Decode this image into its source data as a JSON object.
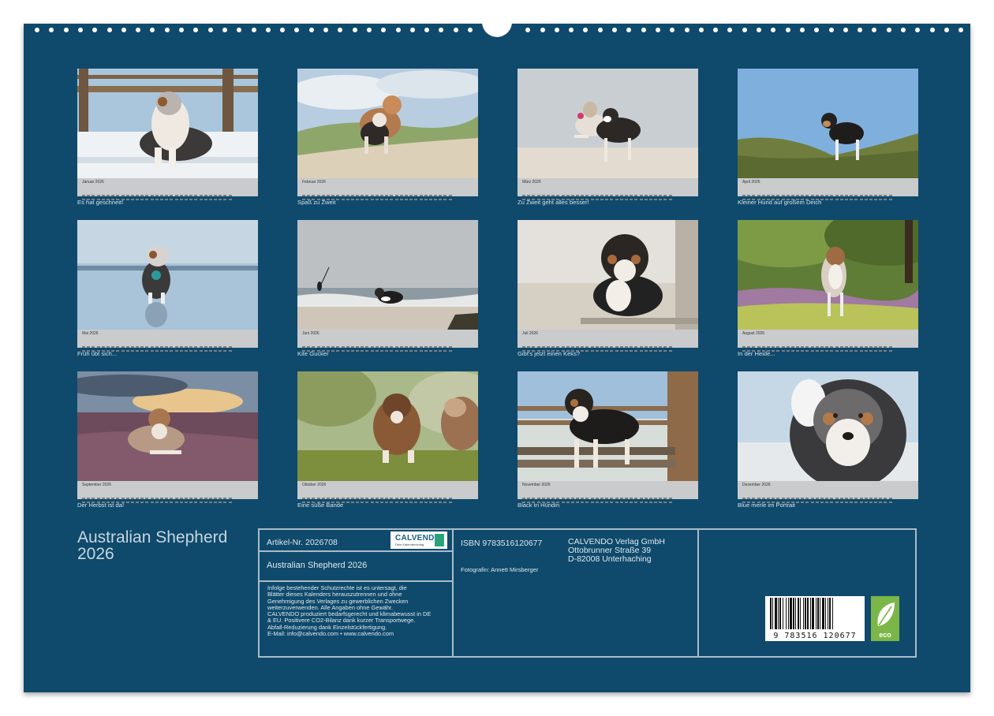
{
  "calendar": {
    "title_line1": "Australian Shepherd",
    "title_line2": "2026",
    "tiles": [
      {
        "month": "Januar 2026",
        "caption": "Es hat geschneit!",
        "scene": "snow-dog"
      },
      {
        "month": "Februar 2026",
        "caption": "Spaß zu Zweit",
        "scene": "dune-two-dogs"
      },
      {
        "month": "März 2026",
        "caption": "Zu Zweit geht alles besser!",
        "scene": "beach-two-dogs"
      },
      {
        "month": "April 2026",
        "caption": "Kleiner Hund auf großem Deich",
        "scene": "dike-puppy"
      },
      {
        "month": "Mai 2026",
        "caption": "Früh übt sich...",
        "scene": "water-puppy"
      },
      {
        "month": "Juni 2026",
        "caption": "Kite Gucker",
        "scene": "kite-beach"
      },
      {
        "month": "Juli 2026",
        "caption": "Gibt's jetzt einen Keks?",
        "scene": "bench-dog"
      },
      {
        "month": "August 2026",
        "caption": "In der Heide...",
        "scene": "heath-dog"
      },
      {
        "month": "September 2026",
        "caption": "Der Herbst ist da!",
        "scene": "sunset-heath"
      },
      {
        "month": "Oktober 2026",
        "caption": "Eine süße Bande",
        "scene": "puppies-grass"
      },
      {
        "month": "November 2026",
        "caption": "Black tri Hündin",
        "scene": "pier-dog"
      },
      {
        "month": "Dezember 2026",
        "caption": "Blue merle im Portrait",
        "scene": "portrait-merle"
      }
    ]
  },
  "info": {
    "article": "Artikel-Nr. 2026708",
    "logo": "CALVENDO",
    "logo_sub": "Dein Kalenderverlag",
    "product_title": "Australian Shepherd 2026",
    "legal_lines": [
      "Infolge bestehender Schutzrechte ist es untersagt, die",
      "Blätter dieses Kalenders herauszutrennen und ohne",
      "Genehmigung des Verlages zu gewerblichen Zwecken",
      "weiterzuverwenden. Alle Angaben ohne Gewähr.",
      "CALVENDO produziert bedarfsgerecht und klimabewusst in DE",
      "& EU. Positivere CO2-Bilanz dank kurzer Transportwege.",
      "Abfall-Reduzierung dank Einzelstückfertigung.",
      "E-Mail: info@calvendo.com • www.calvendo.com"
    ],
    "isbn": "ISBN 9783516120677",
    "photographer": "Fotografin: Annett Mirsberger",
    "publisher": [
      "CALVENDO Verlag GmbH",
      "Ottobrunner Straße 39",
      "D-82008 Unterhaching"
    ],
    "barcode_number": "9 783516 120677",
    "eco_label": "eco"
  },
  "colors": {
    "background": "#0f4a6c",
    "frame": "#a9bcc8",
    "strip": "#c9cbcd"
  }
}
